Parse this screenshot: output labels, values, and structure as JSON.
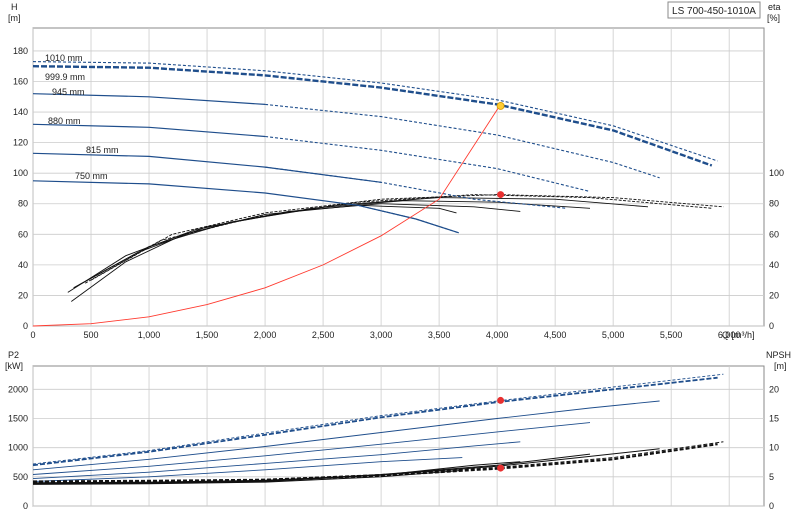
{
  "model_label": "LS 700-450-1010A",
  "colors": {
    "grid": "#cccccc",
    "frame": "#8a8a8a",
    "curve": "#1f4e8c",
    "efficiency": "#111111",
    "system_curve": "#ff3b30",
    "duty_point": "#e83030",
    "duty_point_head": "#ffcc33"
  },
  "chart_data": [
    {
      "type": "line",
      "name": "head",
      "xlabel": "Q [m³/h]",
      "ylabel_left_top": "H",
      "ylabel_left_unit": "[m]",
      "ylabel_right_top": "eta",
      "ylabel_right_unit": "[%]",
      "xlim": [
        0,
        6300
      ],
      "ylim": [
        0,
        195
      ],
      "x_ticks": [
        0,
        500,
        1000,
        1500,
        2000,
        2500,
        3000,
        3500,
        4000,
        4500,
        5000,
        5500,
        6000
      ],
      "x_tick_labels": [
        "0",
        "500",
        "1,000",
        "1,500",
        "2,000",
        "2,500",
        "3,000",
        "3,500",
        "4,000",
        "4,500",
        "5,000",
        "5,500",
        "6,000"
      ],
      "y_ticks": [
        0,
        20,
        40,
        60,
        80,
        100,
        120,
        140,
        160,
        180
      ],
      "y_tick_labels": [
        "0",
        "20",
        "40",
        "60",
        "80",
        "100",
        "120",
        "140",
        "160",
        "180"
      ],
      "eta_ticks": [
        0,
        20,
        40,
        60,
        80,
        100
      ],
      "eta_tick_labels": [
        "0",
        "20",
        "40",
        "60",
        "80",
        "100"
      ],
      "impeller_curves": [
        {
          "label": "1010 mm",
          "points": [
            [
              0,
              173
            ],
            [
              1000,
              172
            ],
            [
              2000,
              167
            ],
            [
              3000,
              159
            ],
            [
              4000,
              148
            ],
            [
              5000,
              131
            ],
            [
              5900,
              108
            ]
          ],
          "solid_until": 800
        },
        {
          "label": "999.9 mm",
          "points": [
            [
              0,
              170
            ],
            [
              1000,
              169
            ],
            [
              2000,
              164
            ],
            [
              3000,
              156
            ],
            [
              4000,
              145
            ],
            [
              5000,
              128
            ],
            [
              5850,
              105
            ]
          ],
          "solid_until": 0,
          "bold": true
        },
        {
          "label": "945 mm",
          "points": [
            [
              0,
              152
            ],
            [
              1000,
              150
            ],
            [
              2000,
              145
            ],
            [
              3000,
              137
            ],
            [
              4000,
              125
            ],
            [
              5000,
              107
            ],
            [
              5400,
              97
            ]
          ],
          "solid_until": 2500
        },
        {
          "label": "880 mm",
          "points": [
            [
              0,
              132
            ],
            [
              1000,
              130
            ],
            [
              2000,
              124
            ],
            [
              3000,
              115
            ],
            [
              4000,
              103
            ],
            [
              4800,
              88
            ]
          ],
          "solid_until": 2800
        },
        {
          "label": "815 mm",
          "points": [
            [
              0,
              113
            ],
            [
              1000,
              111
            ],
            [
              2000,
              104
            ],
            [
              3000,
              94
            ],
            [
              3800,
              83
            ],
            [
              4600,
              77
            ]
          ],
          "solid_until": 3000
        },
        {
          "label": "750 mm",
          "points": [
            [
              0,
              95
            ],
            [
              1000,
              93
            ],
            [
              2000,
              87
            ],
            [
              2800,
              79
            ],
            [
              3300,
              70
            ],
            [
              3670,
              61
            ]
          ],
          "solid_until": 3670
        }
      ],
      "efficiency_curves": [
        {
          "points": [
            [
              330,
              16
            ],
            [
              800,
              42
            ],
            [
              1300,
              60
            ],
            [
              2000,
              73
            ],
            [
              2800,
              79
            ],
            [
              3500,
              77
            ],
            [
              3650,
              74
            ]
          ]
        },
        {
          "points": [
            [
              300,
              22
            ],
            [
              800,
              46
            ],
            [
              1400,
              63
            ],
            [
              2200,
              75
            ],
            [
              3000,
              80
            ],
            [
              3800,
              78
            ],
            [
              4200,
              75
            ]
          ]
        },
        {
          "points": [
            [
              350,
              25
            ],
            [
              900,
              48
            ],
            [
              1500,
              65
            ],
            [
              2400,
              77
            ],
            [
              3200,
              82
            ],
            [
              4000,
              81
            ],
            [
              4800,
              77
            ]
          ]
        },
        {
          "points": [
            [
              400,
              27
            ],
            [
              1000,
              52
            ],
            [
              1700,
              68
            ],
            [
              2600,
              79
            ],
            [
              3500,
              84
            ],
            [
              4500,
              83
            ],
            [
              5300,
              78
            ]
          ]
        },
        {
          "points": [
            [
              450,
              28
            ],
            [
              1100,
              56
            ],
            [
              1900,
              71
            ],
            [
              2800,
              81
            ],
            [
              3800,
              86
            ],
            [
              4800,
              84
            ],
            [
              5850,
              77
            ]
          ]
        },
        {
          "points": [
            [
              500,
              30
            ],
            [
              1200,
              60
            ],
            [
              2000,
              74
            ],
            [
              3000,
              83
            ],
            [
              4000,
              86
            ],
            [
              5000,
              84
            ],
            [
              5950,
              78
            ]
          ]
        }
      ],
      "system_curve": {
        "points": [
          [
            0,
            0
          ],
          [
            500,
            1.5
          ],
          [
            1000,
            6
          ],
          [
            1500,
            14
          ],
          [
            2000,
            25
          ],
          [
            2500,
            40
          ],
          [
            3000,
            59
          ],
          [
            3500,
            83
          ],
          [
            4030,
            145
          ]
        ]
      },
      "duty_points": [
        {
          "series": "head",
          "x": 4030,
          "y": 144
        },
        {
          "series": "efficiency",
          "x": 4030,
          "y": 86
        }
      ]
    },
    {
      "type": "line",
      "name": "power_npsh",
      "xlabel": "",
      "ylabel_left_top": "P2",
      "ylabel_left_unit": "[kW]",
      "ylabel_right_top": "NPSH",
      "ylabel_right_unit": "[m]",
      "xlim": [
        0,
        6300
      ],
      "ylim": [
        0,
        2400
      ],
      "y_ticks": [
        0,
        500,
        1000,
        1500,
        2000
      ],
      "y_tick_labels": [
        "0",
        "500",
        "1000",
        "1500",
        "2000"
      ],
      "npsh_lim": [
        0,
        24
      ],
      "npsh_ticks": [
        0,
        5,
        10,
        15,
        20
      ],
      "npsh_tick_labels": [
        "0",
        "5",
        "10",
        "15",
        "20"
      ],
      "power_curves": [
        {
          "points": [
            [
              0,
              720
            ],
            [
              1000,
              950
            ],
            [
              2000,
              1250
            ],
            [
              3000,
              1550
            ],
            [
              4000,
              1800
            ],
            [
              5000,
              2040
            ],
            [
              5950,
              2260
            ]
          ]
        },
        {
          "points": [
            [
              0,
              700
            ],
            [
              1000,
              930
            ],
            [
              2000,
              1220
            ],
            [
              3000,
              1520
            ],
            [
              4000,
              1780
            ],
            [
              5000,
              2000
            ],
            [
              5900,
              2200
            ]
          ]
        },
        {
          "points": [
            [
              0,
              620
            ],
            [
              1000,
              800
            ],
            [
              2000,
              1020
            ],
            [
              3000,
              1260
            ],
            [
              4000,
              1500
            ],
            [
              4800,
              1680
            ],
            [
              5400,
              1800
            ]
          ]
        },
        {
          "points": [
            [
              0,
              540
            ],
            [
              1000,
              680
            ],
            [
              2000,
              860
            ],
            [
              3000,
              1060
            ],
            [
              4000,
              1270
            ],
            [
              4800,
              1430
            ]
          ]
        },
        {
          "points": [
            [
              0,
              470
            ],
            [
              1000,
              580
            ],
            [
              2000,
              730
            ],
            [
              3000,
              880
            ],
            [
              3800,
              1030
            ],
            [
              4200,
              1100
            ]
          ]
        },
        {
          "points": [
            [
              0,
              420
            ],
            [
              1000,
              500
            ],
            [
              2000,
              620
            ],
            [
              3000,
              760
            ],
            [
              3700,
              830
            ]
          ]
        }
      ],
      "npsh_curves": [
        {
          "points": [
            [
              0,
              4.3
            ],
            [
              1000,
              4.4
            ],
            [
              2000,
              4.6
            ],
            [
              3000,
              5.4
            ],
            [
              4000,
              6.6
            ],
            [
              5000,
              8.3
            ],
            [
              5950,
              11.0
            ]
          ]
        },
        {
          "points": [
            [
              0,
              4.1
            ],
            [
              1000,
              4.2
            ],
            [
              2000,
              4.5
            ],
            [
              3000,
              5.2
            ],
            [
              4000,
              6.4
            ],
            [
              5000,
              8.0
            ],
            [
              5900,
              10.6
            ]
          ]
        },
        {
          "points": [
            [
              0,
              4.0
            ],
            [
              1000,
              4.1
            ],
            [
              2000,
              4.4
            ],
            [
              3000,
              5.3
            ],
            [
              4000,
              6.8
            ],
            [
              4800,
              8.5
            ],
            [
              5400,
              9.8
            ]
          ]
        },
        {
          "points": [
            [
              0,
              3.9
            ],
            [
              1000,
              4.0
            ],
            [
              2000,
              4.3
            ],
            [
              3000,
              5.4
            ],
            [
              4000,
              7.0
            ],
            [
              4800,
              8.9
            ]
          ]
        },
        {
          "points": [
            [
              0,
              3.8
            ],
            [
              1000,
              3.9
            ],
            [
              2000,
              4.2
            ],
            [
              3000,
              5.3
            ],
            [
              3800,
              7.0
            ],
            [
              4200,
              7.6
            ]
          ]
        },
        {
          "points": [
            [
              0,
              3.7
            ],
            [
              1000,
              3.8
            ],
            [
              2000,
              4.1
            ],
            [
              3000,
              5.0
            ],
            [
              3700,
              6.1
            ]
          ]
        }
      ],
      "duty_points": [
        {
          "series": "power",
          "x": 4030,
          "y": 1810
        },
        {
          "series": "npsh",
          "x": 4030,
          "y": 6.5
        }
      ]
    }
  ]
}
